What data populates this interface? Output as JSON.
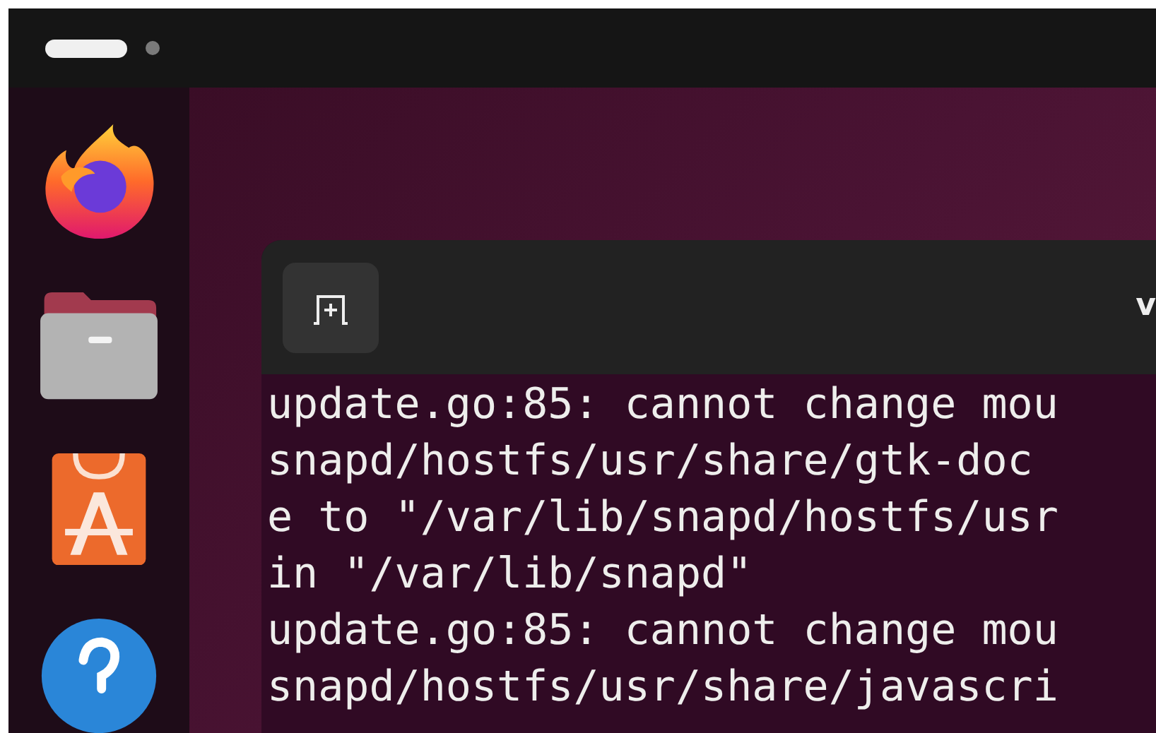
{
  "top_bar": {
    "workspaces": [
      {
        "selected": true
      },
      {
        "selected": false
      }
    ]
  },
  "dock": {
    "apps": [
      {
        "kind": "browser"
      },
      {
        "kind": "files"
      },
      {
        "kind": "store"
      },
      {
        "kind": "help"
      }
    ]
  },
  "terminal": {
    "title": "v",
    "lines": [
      "update.go:85: cannot change mou",
      "snapd/hostfs/usr/share/gtk-doc",
      "e to \"/var/lib/snapd/hostfs/usr",
      "in \"/var/lib/snapd\"",
      "update.go:85: cannot change mou",
      "snapd/hostfs/usr/share/javascri"
    ]
  }
}
